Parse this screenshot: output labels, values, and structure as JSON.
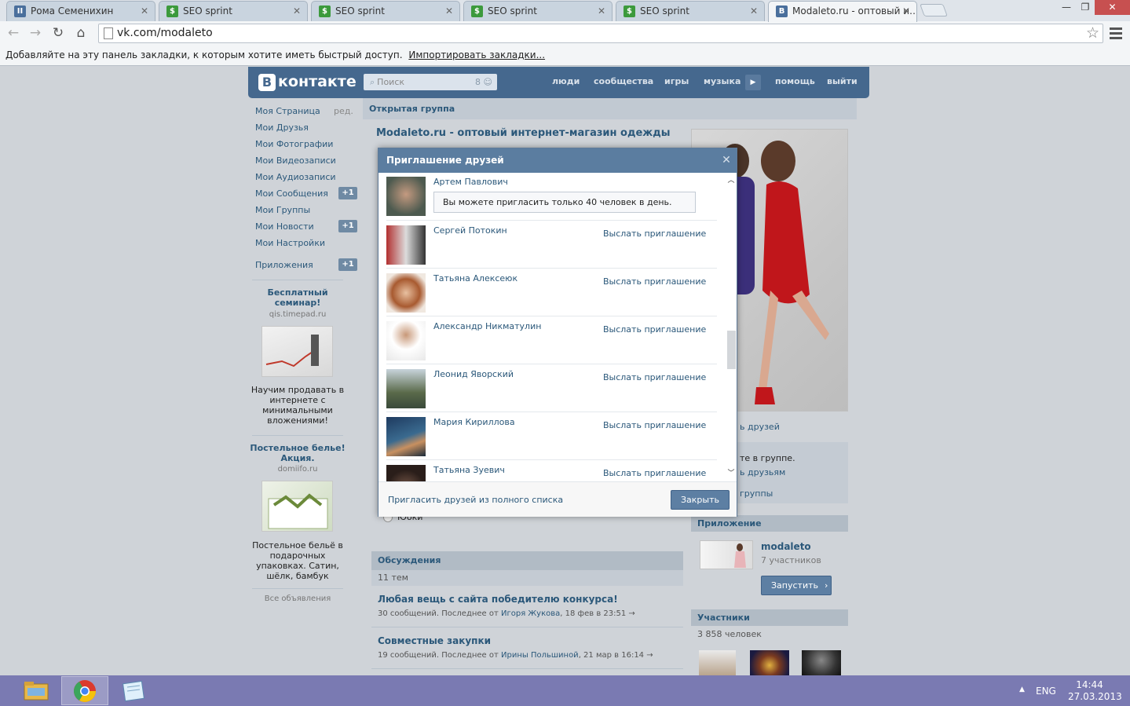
{
  "browser": {
    "tabs": [
      {
        "title": "Рома Семенихин",
        "icon": "vk-pause-icon",
        "color": "#4a6f9c"
      },
      {
        "title": "SEO sprint",
        "icon": "seo-sprint-icon",
        "color": "#3c9a3c"
      },
      {
        "title": "SEO sprint",
        "icon": "seo-sprint-icon",
        "color": "#3c9a3c"
      },
      {
        "title": "SEO sprint",
        "icon": "seo-sprint-icon",
        "color": "#3c9a3c"
      },
      {
        "title": "SEO sprint",
        "icon": "seo-sprint-icon",
        "color": "#3c9a3c"
      },
      {
        "title": "Modaleto.ru - оптовый и…",
        "icon": "vk-icon",
        "color": "#4a6f9c"
      }
    ],
    "address": "vk.com/modaleto",
    "bookmarks_bar": {
      "text": "Добавляйте на эту панель закладки, к которым хотите иметь быстрый доступ.",
      "link": "Импортировать закладки..."
    }
  },
  "vk": {
    "logo": "контакте",
    "logo_letter": "В",
    "search_placeholder": "Поиск",
    "search_count": "8",
    "nav": [
      "люди",
      "сообщества",
      "игры",
      "музыка",
      "помощь",
      "выйти"
    ],
    "sidebar": {
      "items": [
        {
          "label": "Моя Страница",
          "extra": "ред."
        },
        {
          "label": "Мои Друзья"
        },
        {
          "label": "Мои Фотографии"
        },
        {
          "label": "Мои Видеозаписи"
        },
        {
          "label": "Мои Аудиозаписи"
        },
        {
          "label": "Мои Сообщения",
          "badge": "+1"
        },
        {
          "label": "Мои Группы"
        },
        {
          "label": "Мои Новости",
          "badge": "+1"
        },
        {
          "label": "Мои Настройки"
        },
        {
          "label": "Приложения",
          "badge": "+1"
        }
      ],
      "ads": [
        {
          "title": "Бесплатный семинар!",
          "domain": "qis.timepad.ru",
          "text": "Научим продавать в интернете с минимальными вложениями!"
        },
        {
          "title": "Постельное белье! Акция.",
          "domain": "domiifo.ru",
          "text": "Постельное бельё в подарочных упаковках. Сатин, шёлк, бамбук"
        }
      ],
      "all_ads": "Все объявления"
    },
    "group": {
      "type_header": "Открытая группа",
      "name": "Modaleto.ru - оптовый интернет-магазин одежды",
      "poll_option": "Юбки",
      "discussions_header": "Обсуждения",
      "topics_count": "11 тем",
      "topics": [
        {
          "title": "Любая вещь с сайта победителю конкурса!",
          "meta_prefix": "30 сообщений. Последнее от",
          "author": "Игоря Жукова",
          "date": ", 18 фев в 23:51"
        },
        {
          "title": "Совместные закупки",
          "meta_prefix": "19 сообщений. Последнее от",
          "author": "Ирины Польшиной",
          "date": ", 21 мар в 16:14"
        }
      ],
      "right": {
        "invite_tail": "ь друзей",
        "in_group": "те в группе.",
        "tell_friends": "ь друзьям",
        "groups_tail": "группы",
        "app_header": "Приложение",
        "app_name": "modaleto",
        "app_members": "7 участников",
        "app_launch": "Запустить",
        "members_header": "Участники",
        "members_count": "3 858 человек"
      }
    }
  },
  "modal": {
    "title": "Приглашение друзей",
    "limit_notice": "Вы можете пригласить только 40 человек в день.",
    "invite_label": "Выслать приглашение",
    "friends": [
      {
        "name": "Артем Павлович",
        "ava": "#4d5a4f"
      },
      {
        "name": "Сергей Потокин",
        "ava": "#9c3a3a"
      },
      {
        "name": "Татьяна Алексеюк",
        "ava": "#b2754f"
      },
      {
        "name": "Александр Никматулин",
        "ava": "#d6d6d6"
      },
      {
        "name": "Леонид Яворский",
        "ava": "#6a7a5a"
      },
      {
        "name": "Мария Кириллова",
        "ava": "#2e4a6b"
      },
      {
        "name": "Татьяна Зуевич",
        "ava": "#3a2e2a"
      }
    ],
    "footer_link": "Пригласить друзей из полного списка",
    "close_button": "Закрыть"
  },
  "taskbar": {
    "apps": [
      "file-explorer-icon",
      "chrome-icon",
      "notepad-icon"
    ],
    "lang": "ENG",
    "time": "14:44",
    "date": "27.03.2013"
  }
}
